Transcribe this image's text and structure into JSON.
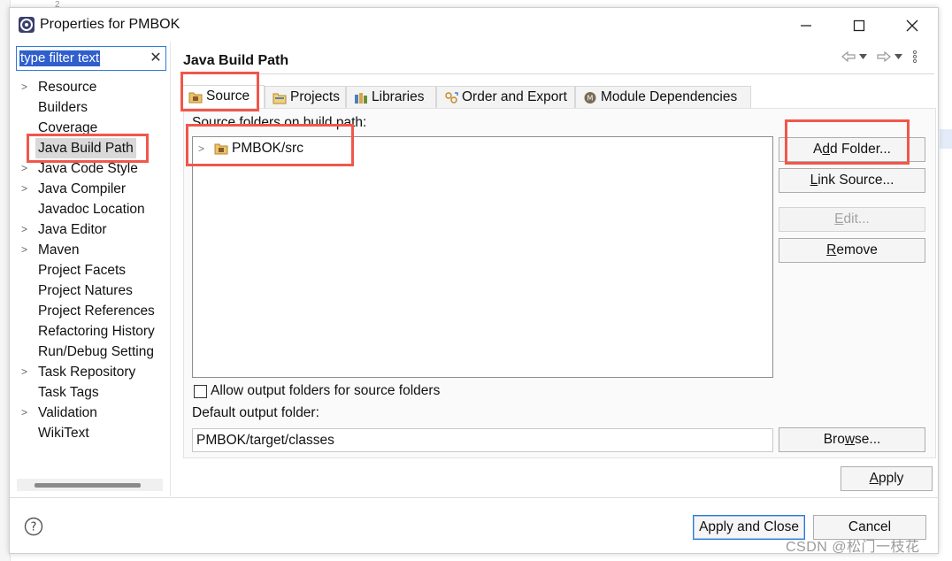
{
  "window": {
    "title": "Properties for PMBOK",
    "minimize_label": "—",
    "maximize_label": "☐",
    "close_label": "✕"
  },
  "filter": {
    "placeholder": "type filter text",
    "clear_icon": "clear-icon"
  },
  "tree": {
    "items": [
      {
        "label": "Resource",
        "expandable": true
      },
      {
        "label": "Builders",
        "expandable": false
      },
      {
        "label": "Coverage",
        "expandable": false
      },
      {
        "label": "Java Build Path",
        "expandable": false,
        "selected": true
      },
      {
        "label": "Java Code Style",
        "expandable": true
      },
      {
        "label": "Java Compiler",
        "expandable": true
      },
      {
        "label": "Javadoc Location",
        "expandable": false
      },
      {
        "label": "Java Editor",
        "expandable": true
      },
      {
        "label": "Maven",
        "expandable": true
      },
      {
        "label": "Project Facets",
        "expandable": false
      },
      {
        "label": "Project Natures",
        "expandable": false
      },
      {
        "label": "Project References",
        "expandable": false
      },
      {
        "label": "Refactoring History",
        "expandable": false
      },
      {
        "label": "Run/Debug Setting",
        "expandable": false
      },
      {
        "label": "Task Repository",
        "expandable": true
      },
      {
        "label": "Task Tags",
        "expandable": false
      },
      {
        "label": "Validation",
        "expandable": true
      },
      {
        "label": "WikiText",
        "expandable": false
      }
    ]
  },
  "page": {
    "title": "Java Build Path"
  },
  "tabs": [
    {
      "label": "Source",
      "icon": "source-folder-icon",
      "active": true
    },
    {
      "label": "Projects",
      "icon": "projects-icon",
      "active": false
    },
    {
      "label": "Libraries",
      "icon": "libraries-icon",
      "active": false
    },
    {
      "label": "Order and Export",
      "icon": "order-export-icon",
      "active": false
    },
    {
      "label": "Module Dependencies",
      "icon": "module-icon",
      "active": false
    }
  ],
  "source": {
    "list_label": "Source folders on build path:",
    "folders": [
      "PMBOK/src"
    ],
    "allow_output_label": "Allow output folders for source folders",
    "allow_output_checked": false,
    "default_output_label": "Default output folder:",
    "default_output_value": "PMBOK/target/classes"
  },
  "buttons": {
    "add_folder": "Add Folder...",
    "link_source": "Link Source...",
    "edit": "Edit...",
    "remove": "Remove",
    "browse": "Browse...",
    "apply": "Apply",
    "apply_close": "Apply and Close",
    "cancel": "Cancel"
  },
  "watermark": "CSDN @松门一枝花",
  "colors": {
    "annotation_red": "#f0574b",
    "selection_blue": "#2f5fcd"
  }
}
